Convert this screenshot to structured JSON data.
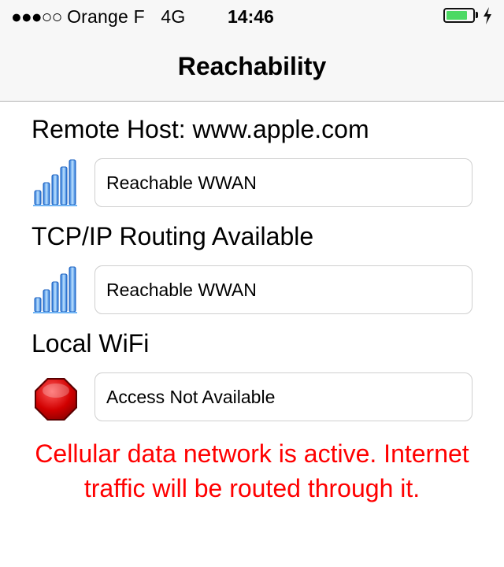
{
  "status_bar": {
    "signal_dots": "●●●○○",
    "carrier": "Orange F",
    "network_type": "4G",
    "time": "14:46",
    "battery_color": "#4cd964"
  },
  "nav": {
    "title": "Reachability"
  },
  "remote_host": {
    "label": "Remote Host: www.apple.com",
    "status": "Reachable WWAN",
    "icon": "wwan-signal-icon"
  },
  "internet": {
    "label": "TCP/IP Routing Available",
    "status": "Reachable WWAN",
    "icon": "wwan-signal-icon"
  },
  "local_wifi": {
    "label": "Local WiFi",
    "status": "Access Not Available",
    "icon": "stop-sign-icon"
  },
  "summary": {
    "message": "Cellular data network is active. Internet traffic will be routed through it.",
    "color": "#ff0000"
  }
}
